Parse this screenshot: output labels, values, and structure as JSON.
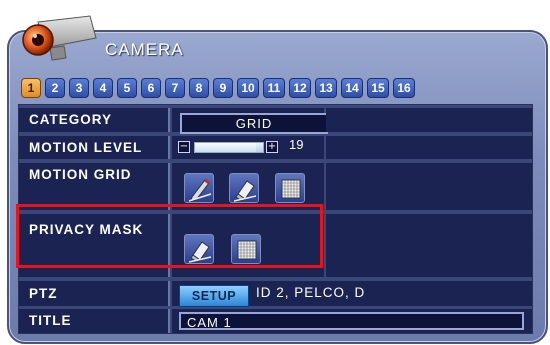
{
  "header": {
    "title": "CAMERA"
  },
  "tabs": [
    "1",
    "2",
    "3",
    "4",
    "5",
    "6",
    "7",
    "8",
    "9",
    "10",
    "11",
    "12",
    "13",
    "14",
    "15",
    "16"
  ],
  "active_tab_index": 0,
  "rows": {
    "category": {
      "label": "CATEGORY",
      "value": "GRID"
    },
    "motion_level": {
      "label": "MOTION LEVEL",
      "value": "19",
      "level_fraction": 0.9
    },
    "motion_grid": {
      "label": "MOTION GRID",
      "tools": [
        "pencil-icon",
        "eraser-icon",
        "grid-icon"
      ]
    },
    "privacy_mask": {
      "label": "PRIVACY MASK",
      "tools": [
        "eraser-icon",
        "grid-icon"
      ]
    },
    "ptz": {
      "label": "PTZ",
      "button": "SETUP",
      "info": "ID 2, PELCO, D"
    },
    "title": {
      "label": "TITLE",
      "value": "CAM  1"
    }
  },
  "slider_controls": {
    "minus": "−",
    "plus": "+"
  },
  "colors": {
    "highlight": "#e8131b",
    "active_tab": "#f0a23b",
    "tab": "#3f63c0",
    "panel": "#7d8cba"
  }
}
